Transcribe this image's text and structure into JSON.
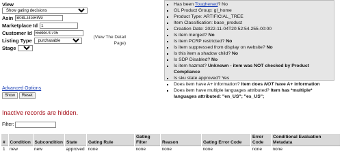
{
  "form": {
    "view_label": "View",
    "view_value": "Show gating decisions",
    "asin_label": "Asin",
    "asin_value": "B08LJ4GHW9",
    "marketplace_label": "Marketplace Id",
    "marketplace_value": "1",
    "customer_label": "Customer Id",
    "customer_value": "6588870705",
    "listing_label": "Listing Type",
    "listing_value": "purchasable",
    "stage_label": "Stage",
    "stage_value": "prod"
  },
  "view_detail": "(View The Detail Page)",
  "info": {
    "item0_prefix": "Has been ",
    "item0_link": "Toughened",
    "item0_suffix": "? No",
    "item1": "GL Product Group: gl_home",
    "item2": "Product Type: ARTIFICIAL_TREE",
    "item3": "Item Classification: base_product",
    "item4": "Creation Date: 2022-11-04T20:52:54.255-00:00",
    "item5_q": "Is item merged? ",
    "item5_a": "No",
    "item6_q": "Is item PCRP restricted? ",
    "item6_a": "No",
    "item7_q": "Is item suppressed from display on website? ",
    "item7_a": "No",
    "item8_q": "Is this item a shadow child? ",
    "item8_a": "No",
    "item9_q": "Is SDP Disabled? ",
    "item9_a": "No",
    "item10_q": "Is item hazmat? ",
    "item10_a": "Unknown - item was NOT checked by Product Compliance",
    "item11": "Is sku state approved? Yes",
    "item12_q": "Does item have A+ information? ",
    "item12_a1": "Item does ",
    "item12_a2": "NOT",
    "item12_a3": " have A+ information",
    "item13_q": "Does item have multiple languages attributed? ",
    "item13_a": "Item has *multiple* languages attributed: \"en_US\"; \"es_US\";"
  },
  "advanced_options": "Advanced Options",
  "buttons": {
    "show": "Show",
    "reset": "Reset"
  },
  "inactive_notice": "Inactive records are hidden.",
  "filter": {
    "label": "Filter:",
    "value": ""
  },
  "table": {
    "headers": [
      "#",
      "Condition",
      "Subcondition",
      "State",
      "Gating Rule",
      "Gating Filter",
      "Reason",
      "Gating Error Code",
      "Error Code",
      "Conditional Evaluation Metadata"
    ],
    "rows": [
      [
        "1",
        "new",
        "new",
        "approved",
        "none",
        "none",
        "none",
        "none",
        "none",
        "none"
      ]
    ]
  }
}
